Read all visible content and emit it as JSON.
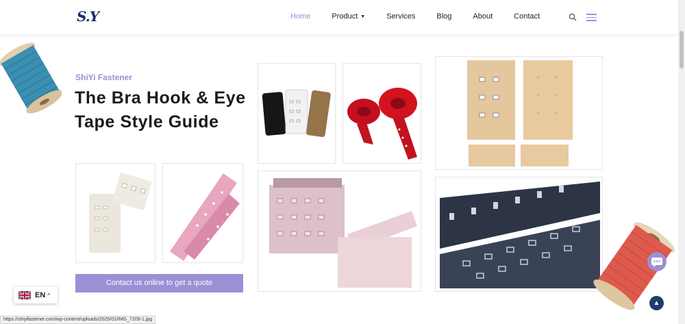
{
  "header": {
    "logo": "S.Y",
    "nav": [
      "Home",
      "Product",
      "Services",
      "Blog",
      "About",
      "Contact"
    ],
    "active_nav": "Home",
    "icons": [
      "search-icon",
      "menu-icon"
    ]
  },
  "hero": {
    "brand": "ShiYi Fastener",
    "title": "The Bra Hook & Eye Tape Style Guide",
    "cta": "Contact us online to get a quote"
  },
  "language": {
    "code": "EN",
    "flag": "uk-flag-icon"
  },
  "status_url": "https://shiyifastener.com/wp-content/uploads/2025/01/IMG_7209-1.jpg",
  "colors": {
    "accent": "#9b8fd6",
    "navy": "#1d3d6b",
    "logo": "#1d2a6b"
  }
}
